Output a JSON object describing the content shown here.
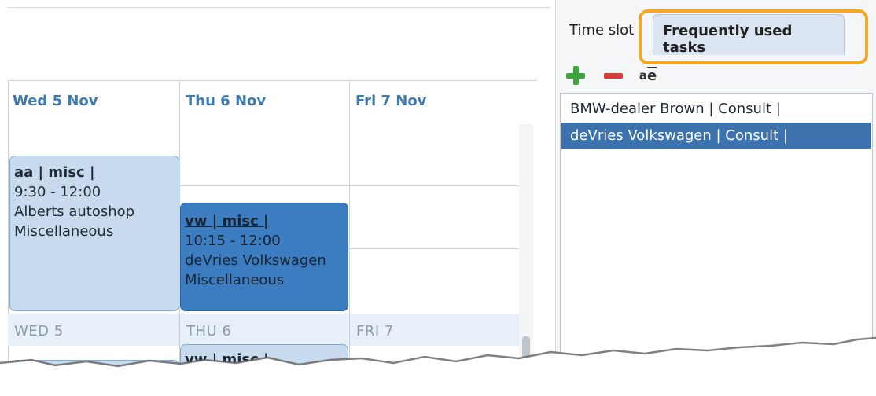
{
  "calendar": {
    "days": [
      {
        "header": "Wed 5 Nov",
        "alt_header": "WED 5"
      },
      {
        "header": "Thu 6 Nov",
        "alt_header": "THU 6"
      },
      {
        "header": "Fri 7 Nov",
        "alt_header": "FRI 7"
      }
    ],
    "events": [
      {
        "title": "aa | misc |",
        "time": "9:30 - 12:00",
        "customer": "Alberts autoshop",
        "category": "Miscellaneous"
      },
      {
        "title": "vw | misc |",
        "time": "10:15 - 12:00",
        "customer": "deVries Volkswagen",
        "category": "Miscellaneous"
      },
      {
        "title": "vw | misc |"
      }
    ]
  },
  "panel": {
    "tabs": [
      {
        "label": "Time slot",
        "active": false
      },
      {
        "label": "Frequently used tasks",
        "active": true
      }
    ],
    "toolbar": {
      "add_icon": "plus-icon",
      "remove_icon": "minus-icon",
      "rename_icon": "rename-icon",
      "rename_a": "a",
      "rename_e": "e"
    },
    "tasks": [
      {
        "label": "BMW-dealer Brown | Consult |",
        "selected": false
      },
      {
        "label": "deVries Volkswagen | Consult |",
        "selected": true
      }
    ]
  },
  "colors": {
    "accent": "#3d7ab0",
    "selection": "#3c72ad",
    "highlight_border": "#f5a623",
    "event_light": "#c8dbee",
    "event_dark": "#3c7cc0"
  }
}
